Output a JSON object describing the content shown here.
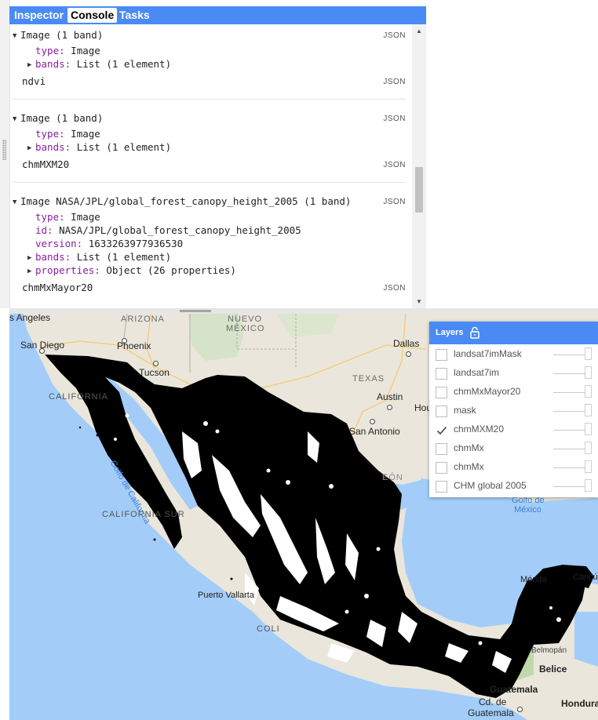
{
  "tabs": [
    "Inspector",
    "Console",
    "Tasks"
  ],
  "console": {
    "entries": [
      {
        "header": "Image (1 band)",
        "fields": [
          {
            "key": "type:",
            "value": "Image",
            "expandable": false
          },
          {
            "key": "bands:",
            "value": "List (1 element)",
            "expandable": true
          }
        ],
        "name": "ndvi"
      },
      {
        "header": "Image (1 band)",
        "fields": [
          {
            "key": "type:",
            "value": "Image",
            "expandable": false
          },
          {
            "key": "bands:",
            "value": "List (1 element)",
            "expandable": true
          }
        ],
        "name": "chmMXM20"
      },
      {
        "header": "Image NASA/JPL/global_forest_canopy_height_2005 (1 band)",
        "fields": [
          {
            "key": "type:",
            "value": "Image",
            "expandable": false
          },
          {
            "key": "id:",
            "value": "NASA/JPL/global_forest_canopy_height_2005",
            "expandable": false
          },
          {
            "key": "version:",
            "value": "1633263977936530",
            "expandable": false
          },
          {
            "key": "bands:",
            "value": "List (1 element)",
            "expandable": true
          },
          {
            "key": "properties:",
            "value": "Object (26 properties)",
            "expandable": true
          }
        ],
        "name": "chmMxMayor20"
      }
    ],
    "json_label": "JSON"
  },
  "map": {
    "labels": {
      "los_angeles": "s Angeles",
      "san_diego": "San Diego",
      "phoenix": "Phoenix",
      "tucson": "Tucson",
      "dallas": "Dallas",
      "austin": "Austin",
      "houston": "Hou",
      "san_antonio": "San Antonio",
      "puerto_vallarta": "Puerto Vallarta",
      "merida": "Mérida",
      "cancun": "Cancún",
      "belmopan": "Belmopán",
      "belice": "Belice",
      "guatemala": "Guatemala",
      "ciudad_guatemala_1": "Cd. de",
      "ciudad_guatemala_2": "Guatemala",
      "honduras": "Hondura"
    },
    "states": {
      "arizona": "ARIZONA",
      "nuevo_mexico_1": "NUEVO",
      "nuevo_mexico_2": "MÉXICO",
      "texas": "TEXAS",
      "california": "CALIFORNIA",
      "baja_california_sur": "CALIFORNIA SUR",
      "colima": "COLI",
      "leon": "EÓN"
    },
    "water": {
      "golfo_california": "Golfo de California",
      "golfo_mexico_1": "Golfo de",
      "golfo_mexico_2": "México"
    }
  },
  "layers": {
    "title": "Layers",
    "items": [
      {
        "name": "landsat7imMask",
        "checked": false
      },
      {
        "name": "landsat7im",
        "checked": false
      },
      {
        "name": "chmMxMayor20",
        "checked": false
      },
      {
        "name": "mask",
        "checked": false
      },
      {
        "name": "chmMXM20",
        "checked": true
      },
      {
        "name": "chmMx",
        "checked": false
      },
      {
        "name": "chmMx",
        "checked": false
      },
      {
        "name": "CHM global 2005",
        "checked": false
      }
    ]
  },
  "colors": {
    "accent": "#4a8af4",
    "key_purple": "#881ea1",
    "water": "#a3cdf8",
    "land": "#eae6db",
    "layer_mask": "#000000"
  }
}
